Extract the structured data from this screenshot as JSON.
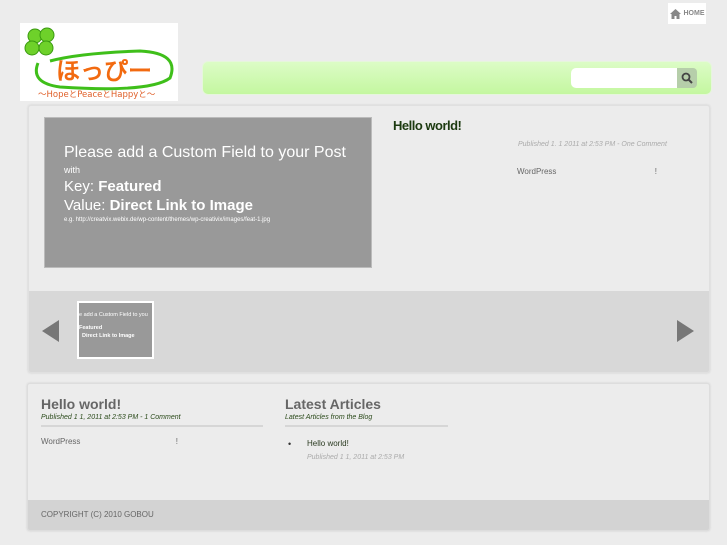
{
  "header": {
    "home_label": "HOME",
    "logo_text": "ほっぴー",
    "logo_tagline": "〜HopeとPeaceとHappyと〜",
    "search_placeholder": ""
  },
  "featured": {
    "title": "Hello world!",
    "meta": "Published 1. 1   2011 at 2:53 PM - One Comment",
    "excerpt": "WordPress",
    "excerpt_end": "!",
    "image": {
      "line1": "Please add a Custom Field to your Post",
      "line2": "with",
      "key_label": "Key: ",
      "key_value": "Featured",
      "value_label": "Value: ",
      "value_value": "Direct Link to Image",
      "example": "e.g. http://creatvix.webix.de/wp-content/themes/wp-creativix/images/feat-1.jpg"
    },
    "thumb": {
      "line1": "e add a Custom Field to you",
      "line2": "Featured",
      "line3": "Direct Link to Image"
    }
  },
  "post": {
    "title": "Hello world!",
    "meta": "Published 1   1, 2011 at 2:53 PM - 1 Comment",
    "excerpt": "WordPress",
    "excerpt_end": "!"
  },
  "latest": {
    "title": "Latest Articles",
    "subtitle": "Latest Articles from the Blog",
    "items": [
      {
        "title": "Hello world!",
        "meta": "Published 1   1, 2011 at 2:53 PM"
      }
    ]
  },
  "footer": {
    "copyright": "COPYRIGHT (C) 2010 GOBOU"
  }
}
